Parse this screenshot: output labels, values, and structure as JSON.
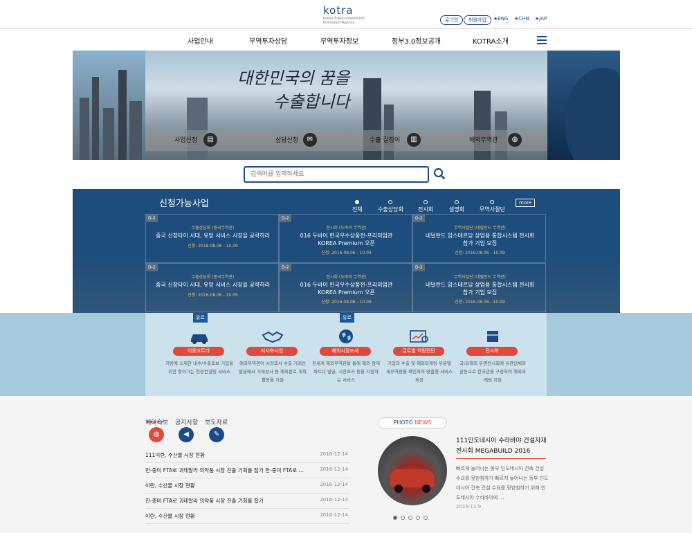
{
  "header": {
    "logo_word": "kotra",
    "logo_sub": "Korea Trade-Investment Promotion Agency",
    "login": "로그인",
    "join": "회원가입",
    "lang_eng": "★ENG",
    "lang_chn": "★CHN",
    "lang_jap": "★JAP"
  },
  "nav": {
    "items": [
      "사업안내",
      "무역투자상담",
      "무역투자정보",
      "정부3.0정보공개",
      "KOTRA소개"
    ]
  },
  "hero": {
    "slogan_line1": "대한민국의 꿈을",
    "slogan_line2": "수출합니다",
    "links": [
      "사업신청",
      "상담신청",
      "수출 길잡이",
      "해외무역관"
    ]
  },
  "search": {
    "placeholder": "검색어를 입력하세요"
  },
  "programs": {
    "title": "신청가능사업",
    "tabs": [
      "전체",
      "수출상담회",
      "전시회",
      "설명회",
      "무역사절단"
    ],
    "more": "more",
    "cards": [
      {
        "dday": "D-2",
        "cat": "수출상담회 (중국무역관)",
        "t1": "중국 신창타이 시대, 유망 서비스 시장을 공략하라",
        "t2": "",
        "date": "신청: 2016.08.06 - 10.09"
      },
      {
        "dday": "D-2",
        "cat": "전시회 (두바이 무역관)",
        "t1": "016 두바이 한국우수상품전-프리미엄관",
        "t2": "KOREA Premium 오픈",
        "date": "신청: 2016.08.06 - 10.09"
      },
      {
        "dday": "D-2",
        "cat": "무역사절단 (네덜란드 무역관)",
        "t1": "네덜란드 암스테르담 상업용 통합시스템 전시회",
        "t2": "참가 기업 모집",
        "date": "신청: 2016.08.06 - 10.09"
      },
      {
        "dday": "D-2",
        "cat": "수출상담회 (중국무역관)",
        "t1": "중국 신창타이 시대, 유망 서비스 시장을 공략하라",
        "t2": "",
        "date": "신청: 2016.08.06 - 10.09"
      },
      {
        "dday": "D-2",
        "cat": "전시회 (두바이 무역관)",
        "t1": "016 두바이 한국우수상품전-프리미엄관",
        "t2": "KOREA Premium 오픈",
        "date": "신청: 2016.08.06 - 10.09"
      },
      {
        "dday": "D-2",
        "cat": "무역사절단 (네덜란드 무역관)",
        "t1": "네덜란드 암스테르담 상업용 통합시스템 전시회",
        "t2": "참가 기업 모집",
        "date": "신청: 2016.08.06 - 10.09"
      }
    ]
  },
  "services": {
    "prev": "‹",
    "next": "›",
    "items": [
      {
        "badge": "유료",
        "label": "이동코트라",
        "desc": "지방에 소재한 내수/수출초보 기업을 위한 찾아가는 현장컨설팅 서비스"
      },
      {
        "badge": "",
        "label": "지사화사업",
        "desc": "해외무역관이 시장조사 수출 거래선 발굴에서 거래성사 등 해외판로 개척활동을 지원"
      },
      {
        "badge": "유료",
        "label": "해외시장조사",
        "desc": "전세계 해외무역관을 통해 해외 잠재파트너 발굴, 시장조사 등을 지원하는 서비스"
      },
      {
        "badge": "",
        "label": "글로벌 역량진단",
        "desc": "기업의 수출 및 해외마케팅 부분별 세부역량을 확인하여 맞춤형 서비스 제공"
      },
      {
        "badge": "",
        "label": "전시회",
        "desc": "국내/해외 유명전시회에 유관단체와 공동으로 한국관을 구성하여 해외마케팅 지원"
      }
    ]
  },
  "news": {
    "tabs": [
      "해외속보",
      "공지사항",
      "보도자료"
    ],
    "rows": [
      {
        "title": "111이란, 수산물 시장 현황",
        "date": "2016-12-14"
      },
      {
        "title": "한-중미 FTA로 괴테말라 의약품 시장 진출 기회를 잡기 한-중미 FTA로 …",
        "date": "2016-12-14"
      },
      {
        "title": "이란, 수산물 시장 현황",
        "date": "2016-12-14"
      },
      {
        "title": "한-중미 FTA로 괴테말라 의약품 시장 진출 기회를 잡기",
        "date": "2016-12-14"
      },
      {
        "title": "이란, 수산물 시장 현황",
        "date": "2016-12-14"
      }
    ]
  },
  "photo_news": {
    "badge_photo": "PHOTO",
    "badge_news": "NEWS",
    "title": "111인도네시아 수라바야 건설자재 전시회 MEGABUILD 2016",
    "desc": "빠르게 늘어나는 동부 인도네시아 건축 건설 수요를 뒷받침하기 빠르게 늘어나는 동부 인도네시아 건축 건설 수요를 뒷받침하기 위해 인도네시아 수라바야에 …",
    "date": "2016-11-9"
  },
  "colors": {
    "brand": "#1a4a8a",
    "accent": "#e04a3c",
    "program_bg": "#1c4d7c"
  }
}
